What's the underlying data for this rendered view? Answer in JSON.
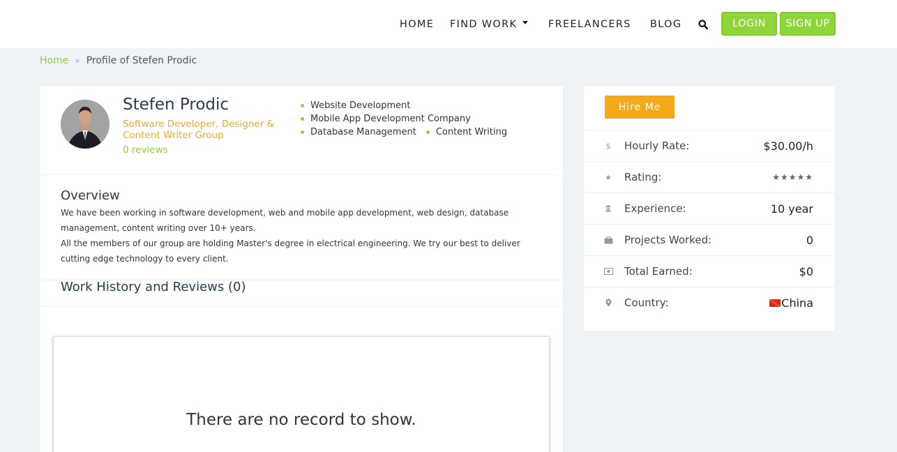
{
  "header": {
    "nav": {
      "home": "HOME",
      "find_work": "FIND WORK",
      "freelancers": "FREELANCERS",
      "blog": "BLOG"
    },
    "login": "LOGIN",
    "signup": "SIGN UP"
  },
  "breadcrumb": {
    "home": "Home",
    "separator": "»",
    "current": "Profile of Stefen Prodic"
  },
  "profile": {
    "name": "Stefen Prodic",
    "title": "Software Developer, Designer & Content Writer Group",
    "reviews": "0 reviews",
    "skills": [
      "Website Development",
      "Mobile App Development Company",
      "Database Management",
      "Content Writing"
    ]
  },
  "overview": {
    "heading": "Overview",
    "paragraph1": "We have been working in software development, web and mobile app development, web design, database management, content writing over 10+ years.",
    "paragraph2": "All the members of our group are holding Master's degree in electrical engineering. We try our best to deliver cutting edge technology to every client."
  },
  "work_history": {
    "heading": "Work History and Reviews (0)",
    "empty_message": "There are no record to show."
  },
  "sidebar": {
    "hire_button": "Hire Me",
    "stats": {
      "hourly_rate": {
        "label": "Hourly Rate:",
        "value": "$30.00/h",
        "icon": "dollar-icon"
      },
      "rating": {
        "label": "Rating:",
        "value": "★★★★★",
        "stars": 5,
        "icon": "star-icon"
      },
      "experience": {
        "label": "Experience:",
        "value": "10 year",
        "icon": "experience-icon"
      },
      "projects": {
        "label": "Projects Worked:",
        "value": "0",
        "icon": "briefcase-icon"
      },
      "earned": {
        "label": "Total Earned:",
        "value": "$0",
        "icon": "money-icon"
      },
      "country": {
        "label": "Country:",
        "value": "China",
        "icon": "map-pin-icon"
      }
    }
  },
  "colors": {
    "accent_green": "#8dd13b",
    "accent_orange": "#f5a623",
    "hire_orange": "#f5a916",
    "background": "#f0f3f6"
  }
}
